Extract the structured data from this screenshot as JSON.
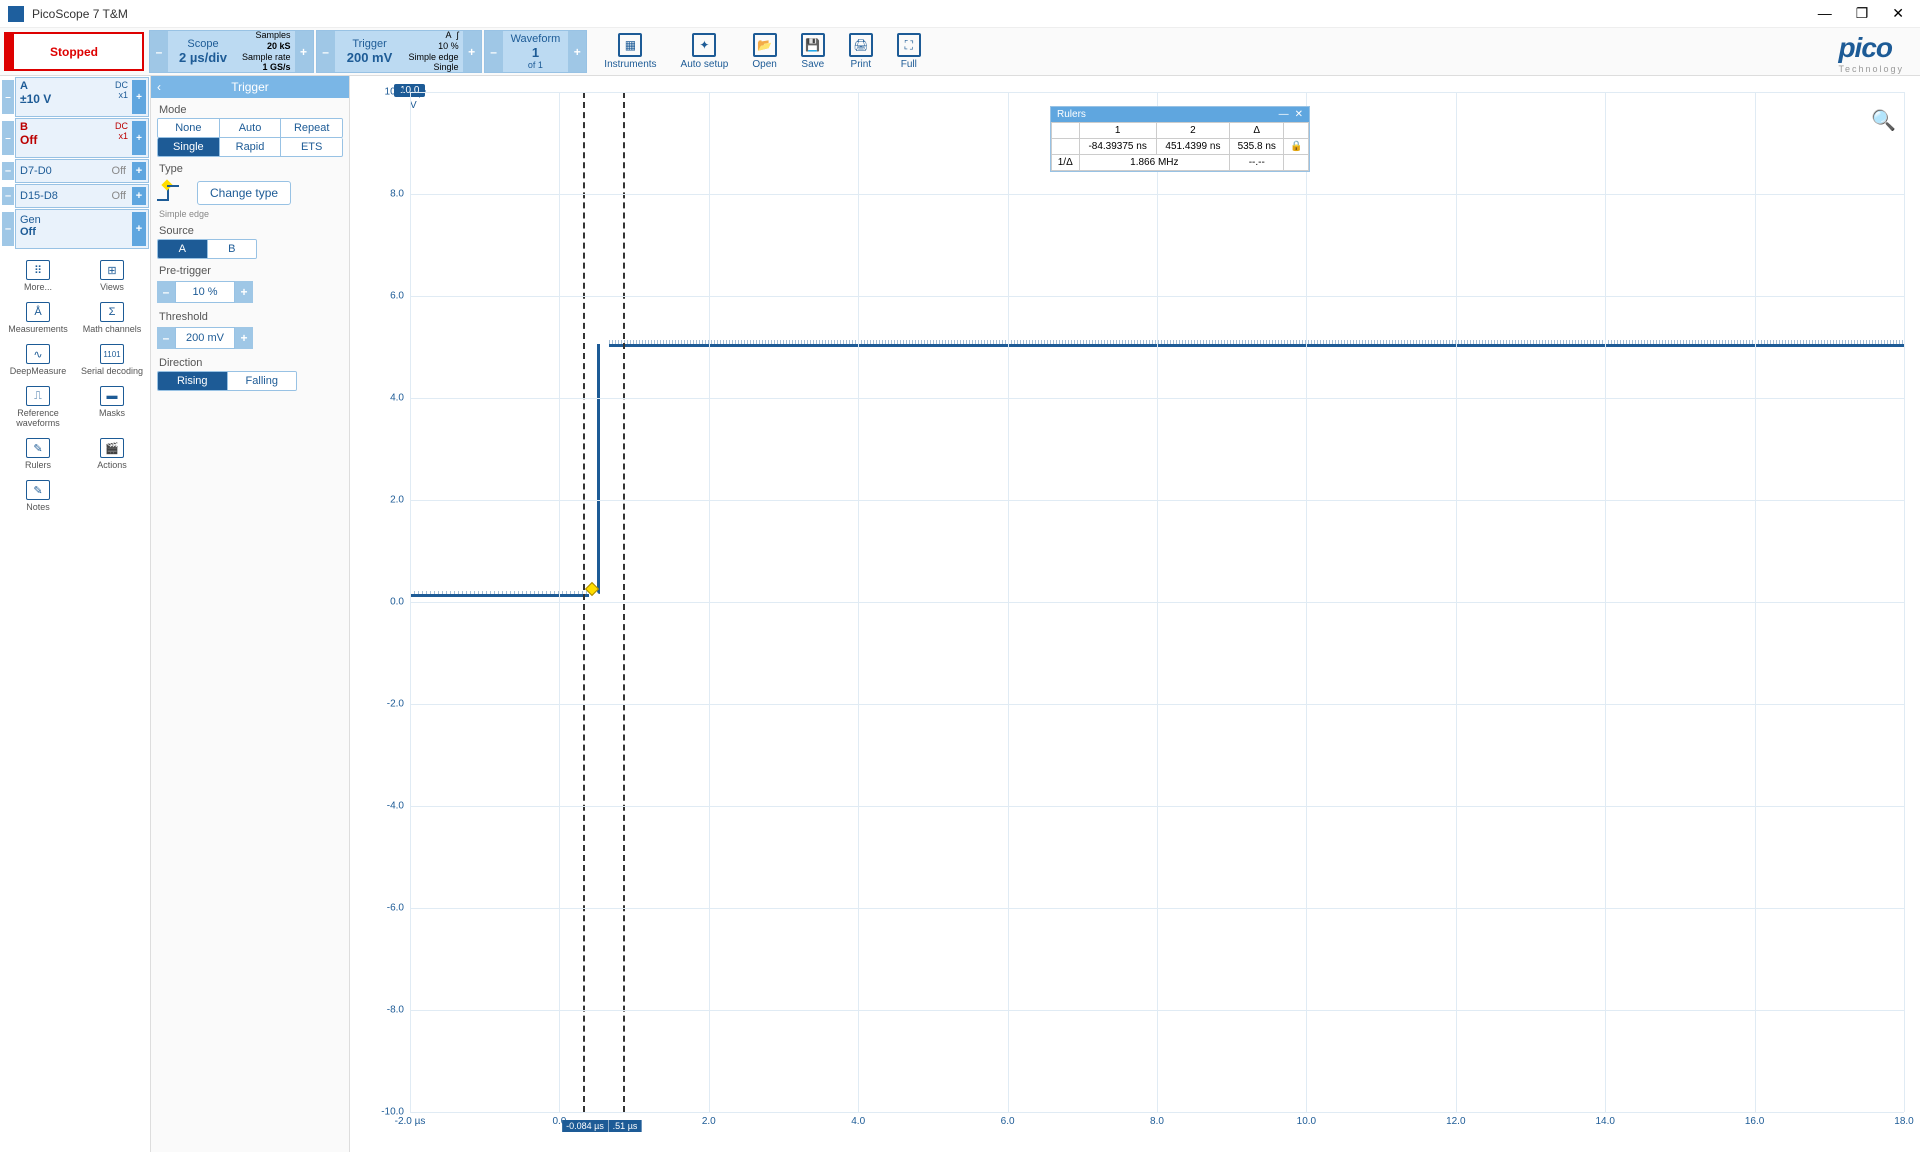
{
  "app": {
    "title": "PicoScope 7 T&M",
    "logo": "pico",
    "logo_sub": "Technology"
  },
  "window_controls": {
    "min": "—",
    "max": "❐",
    "close": "✕"
  },
  "toolbar": {
    "stopped": "Stopped",
    "scope": {
      "title": "Scope",
      "value": "2 µs/div",
      "samples_lbl": "Samples",
      "samples": "20 kS",
      "rate_lbl": "Sample rate",
      "rate": "1 GS/s"
    },
    "trigger": {
      "title": "Trigger",
      "value": "200 mV",
      "a_lbl": "A",
      "edge_glyph": "ʃ",
      "pct": "10 %",
      "simple": "Simple edge",
      "single": "Single"
    },
    "waveform": {
      "title": "Waveform",
      "value": "1",
      "of": "of 1"
    },
    "icons": {
      "instruments": "Instruments",
      "autosetup": "Auto setup",
      "open": "Open",
      "save": "Save",
      "print": "Print",
      "full": "Full"
    }
  },
  "channels": {
    "a": {
      "label": "A",
      "coupling": "DC",
      "probe": "x1",
      "range": "±10 V"
    },
    "b": {
      "label": "B",
      "coupling": "DC",
      "probe": "x1",
      "state": "Off"
    },
    "d7d0": {
      "label": "D7-D0",
      "state": "Off"
    },
    "d15d8": {
      "label": "D15-D8",
      "state": "Off"
    },
    "gen": {
      "label": "Gen",
      "state": "Off"
    }
  },
  "tools": {
    "more": "More...",
    "views": "Views",
    "measurements": "Measurements",
    "mathchannels": "Math channels",
    "deepmeasure": "DeepMeasure",
    "serialdecoding": "Serial decoding",
    "refwaveforms": "Reference waveforms",
    "masks": "Masks",
    "rulers": "Rulers",
    "actions": "Actions",
    "notes": "Notes"
  },
  "trigger_panel": {
    "title": "Trigger",
    "mode_lbl": "Mode",
    "mode": [
      "None",
      "Auto",
      "Repeat",
      "Single",
      "Rapid",
      "ETS"
    ],
    "mode_active": "Single",
    "type_lbl": "Type",
    "change_type": "Change type",
    "simple_edge": "Simple edge",
    "source_lbl": "Source",
    "source": [
      "A",
      "B"
    ],
    "source_active": "A",
    "pretrigger_lbl": "Pre-trigger",
    "pretrigger_val": "10 %",
    "threshold_lbl": "Threshold",
    "threshold_val": "200 mV",
    "direction_lbl": "Direction",
    "direction": [
      "Rising",
      "Falling"
    ],
    "direction_active": "Rising"
  },
  "chart_data": {
    "type": "line",
    "title": "",
    "xlabel": "µs",
    "ylabel": "V",
    "xlim": [
      -2.0,
      18.0
    ],
    "ylim": [
      -10.0,
      10.0
    ],
    "y_ticks": [
      -10.0,
      -8.0,
      -6.0,
      -4.0,
      -2.0,
      0.0,
      2.0,
      4.0,
      6.0,
      8.0,
      10.0
    ],
    "x_ticks": [
      -2.0,
      0.0,
      2.0,
      4.0,
      6.0,
      8.0,
      10.0,
      12.0,
      14.0,
      16.0,
      18.0
    ],
    "y_badge": "10.0",
    "y_unit": "V",
    "series": [
      {
        "name": "A",
        "color": "#1d5b96",
        "x": [
          -2.0,
          0.0,
          0.05,
          0.1,
          18.0
        ],
        "y": [
          0.15,
          0.15,
          2.5,
          5.05,
          5.05
        ]
      }
    ],
    "time_rulers": [
      {
        "id": 1,
        "x_us": -0.084,
        "label": "-0.084 µs"
      },
      {
        "id": 2,
        "x_us": 0.451,
        "label": ".51 µs"
      }
    ],
    "trigger_marker": {
      "x_us": 0.0,
      "y_v": 0.2
    }
  },
  "rulers_window": {
    "title": "Rulers",
    "cols": [
      "",
      "1",
      "2",
      "Δ",
      ""
    ],
    "row_time": [
      "",
      "-84.39375 ns",
      "451.4399 ns",
      "535.8 ns",
      "🔒"
    ],
    "row_freq": [
      "1/Δ",
      "1.866 MHz",
      "",
      "--.--",
      ""
    ]
  },
  "plus": "+",
  "minus": "–"
}
